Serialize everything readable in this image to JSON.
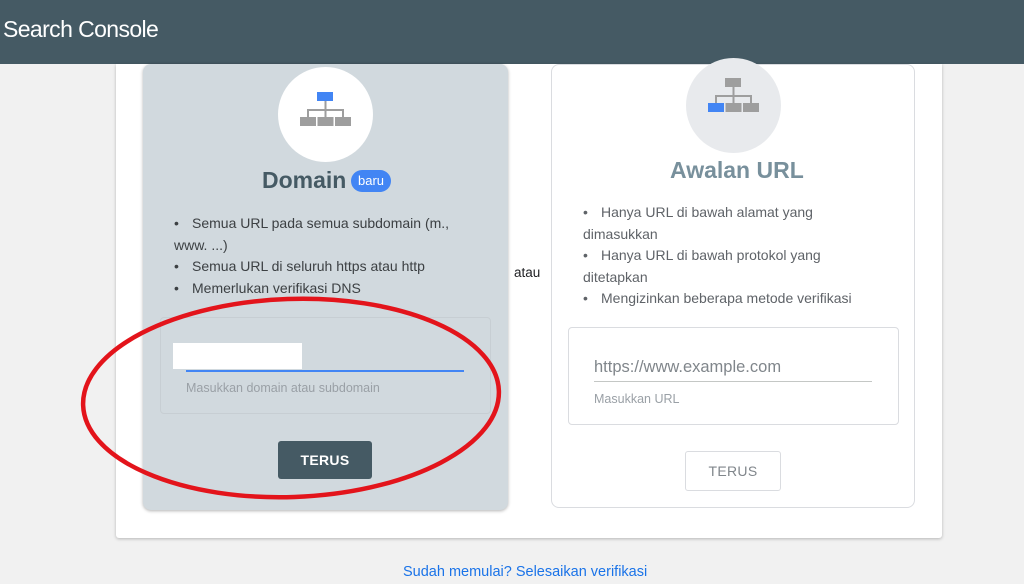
{
  "header": {
    "brand": "Search Console"
  },
  "domain_card": {
    "title": "Domain",
    "badge": "baru",
    "bullets": [
      "Semua URL pada semua subdomain (m.,",
      "www. ...)",
      "Semua URL di seluruh https atau http",
      "Memerlukan verifikasi DNS"
    ],
    "input_value": "",
    "input_hint": "Masukkan domain atau subdomain",
    "continue_label": "TERUS"
  },
  "separator": {
    "label": "atau"
  },
  "url_card": {
    "title": "Awalan URL",
    "bullets": [
      "Hanya URL di bawah alamat yang",
      "dimasukkan",
      "Hanya URL di bawah protokol yang",
      "ditetapkan",
      "Mengizinkan beberapa metode verifikasi"
    ],
    "input_placeholder": "https://www.example.com",
    "input_hint": "Masukkan URL",
    "continue_label": "TERUS"
  },
  "footer": {
    "link_text": "Sudah memulai? Selesaikan verifikasi"
  },
  "colors": {
    "header_bg": "#455a64",
    "domain_card_bg": "#d1d9de",
    "accent_blue": "#4285f4",
    "link_blue": "#1a73e8",
    "annotation_red": "#e3141b"
  },
  "icons": [
    "sitemap-icon-domain",
    "sitemap-icon-url"
  ]
}
